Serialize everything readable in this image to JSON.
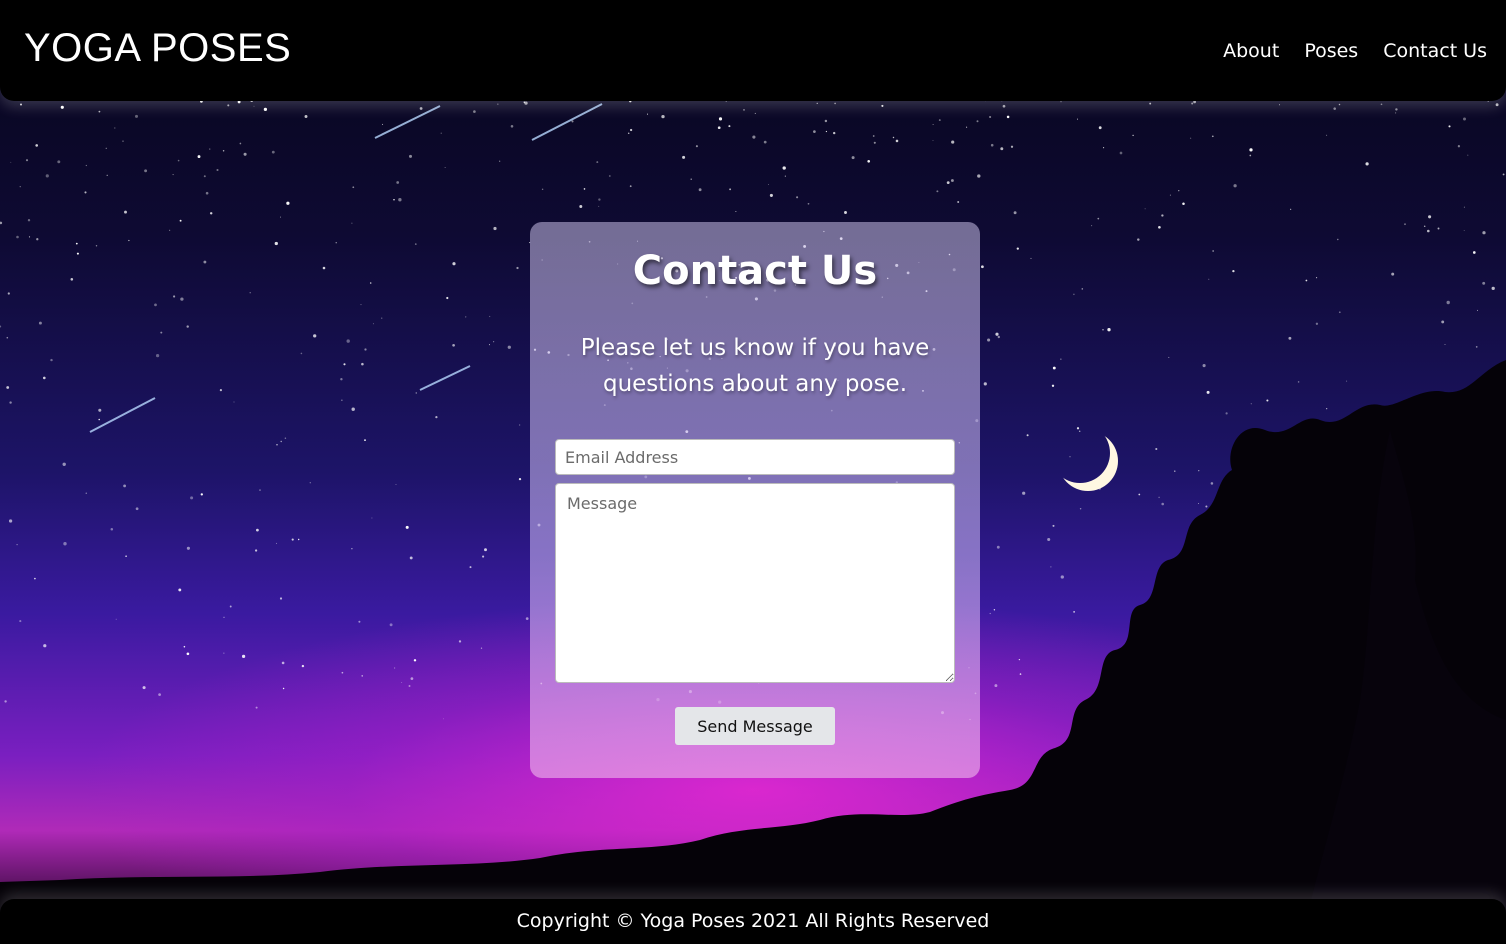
{
  "header": {
    "brand": "YOGA POSES",
    "nav": [
      "About",
      "Poses",
      "Contact Us"
    ]
  },
  "contact": {
    "title": "Contact Us",
    "lead": "Please let us know if you have questions about any pose.",
    "email_placeholder": "Email Address",
    "message_placeholder": "Message",
    "send_label": "Send Message"
  },
  "footer": {
    "copyright": "Copyright © Yoga Poses 2021 All Rights Reserved"
  },
  "background": {
    "scene": "night-sky-with-stars-moon-and-trees",
    "colors": {
      "sky_top": "#07051a",
      "sky_mid": "#3a1aa0",
      "glow": "#e628d2"
    }
  }
}
